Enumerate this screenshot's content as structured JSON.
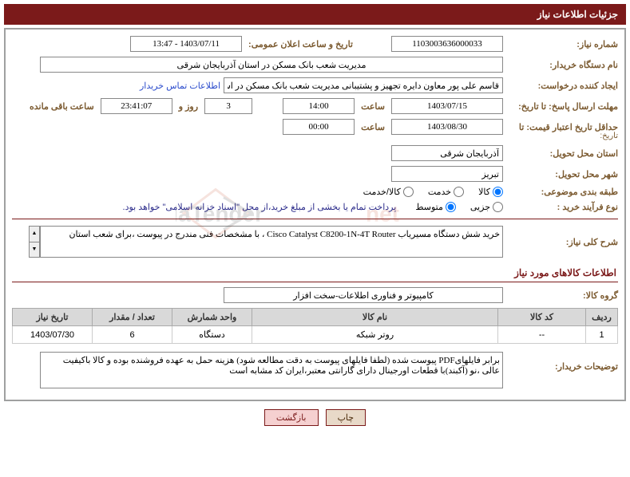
{
  "header": {
    "title": "جزئیات اطلاعات نیاز"
  },
  "fields": {
    "need_no_label": "شماره نیاز:",
    "need_no": "1103003636000033",
    "announce_label": "تاریخ و ساعت اعلان عمومی:",
    "announce_value": "1403/07/11 - 13:47",
    "buyer_org_label": "نام دستگاه خریدار:",
    "buyer_org": "مدیریت شعب بانک مسکن در استان آذربایجان شرقی",
    "requester_label": "ایجاد کننده درخواست:",
    "requester": "قاسم علی پور معاون دایره تجهیز و پشتیبانی مدیریت شعب بانک مسکن در است",
    "contact_link": "اطلاعات تماس خریدار",
    "deadline_send_label": "مهلت ارسال پاسخ: تا تاریخ:",
    "date_sublabel": "تاریخ:",
    "deadline_date": "1403/07/15",
    "time_label": "ساعت",
    "deadline_time": "14:00",
    "days_count": "3",
    "days_and": "روز و",
    "countdown": "23:41:07",
    "remaining": "ساعت باقی مانده",
    "min_valid_label": "حداقل تاریخ اعتبار قیمت: تا",
    "min_valid_date": "1403/08/30",
    "min_valid_time": "00:00",
    "province_label": "استان محل تحویل:",
    "province": "آذربایجان شرقی",
    "city_label": "شهر محل تحویل:",
    "city": "تبریز",
    "class_label": "طبقه بندی موضوعی:",
    "process_label": "نوع فرآیند خرید :",
    "payment_note": "پرداخت تمام یا بخشی از مبلغ خرید،از محل \"اسناد خزانه اسلامی\" خواهد بود.",
    "radios": {
      "kala": "کالا",
      "khedmat": "خدمت",
      "kala_khedmat": "کالا/خدمت",
      "jozee": "جزیی",
      "motavaset": "متوسط"
    },
    "desc_label": "شرح کلی نیاز:",
    "desc": "خرید شش دستگاه مسیریاب Cisco Catalyst C8200-1N-4T Router ، با مشخصات فنی مندرج در پیوست ،برای شعب استان",
    "section_title": "اطلاعات کالاهای مورد نیاز",
    "group_label": "گروه کالا:",
    "group": "کامپیوتر و فناوری اطلاعات-سخت افزار",
    "buyer_notes_label": "توضیحات خریدار:",
    "buyer_notes": "برابر فایلهایPDF پیوست شده (لطفا فایلهای پیوست به دقت مطالعه شود) هزینه حمل به عهده فروشنده بوده و کالا باکیفیت عالی ،نو (آکبند)با قطعات اورجینال دارای گارانتی معتبر،ایران کد مشابه است"
  },
  "table": {
    "headers": {
      "row": "ردیف",
      "code": "کد کالا",
      "name": "نام کالا",
      "unit": "واحد شمارش",
      "qty": "تعداد / مقدار",
      "date": "تاریخ نیاز"
    },
    "rows": [
      {
        "row": "1",
        "code": "--",
        "name": "روتر شبکه",
        "unit": "دستگاه",
        "qty": "6",
        "date": "1403/07/30"
      }
    ]
  },
  "buttons": {
    "print": "چاپ",
    "back": "بازگشت"
  }
}
